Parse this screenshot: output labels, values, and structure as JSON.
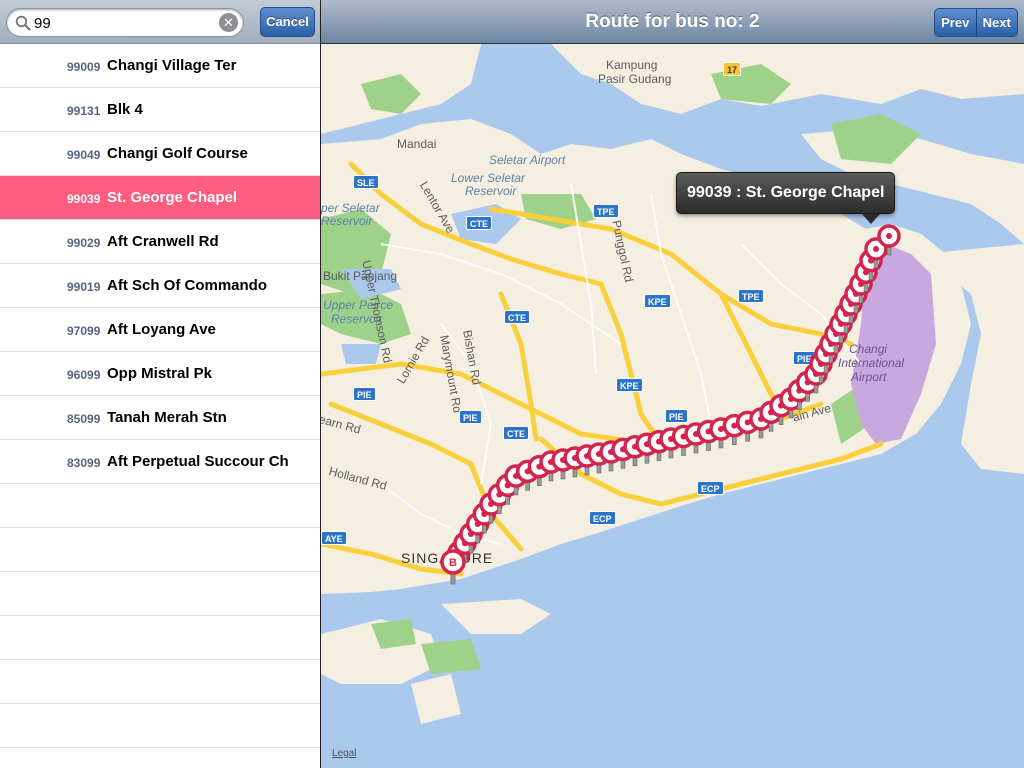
{
  "search": {
    "value": "99",
    "placeholder": "",
    "clear_icon": "clear-icon",
    "cancel_label": "Cancel"
  },
  "stops": [
    {
      "code": "99009",
      "name": "Changi Village Ter",
      "selected": false
    },
    {
      "code": "99131",
      "name": "Blk 4",
      "selected": false
    },
    {
      "code": "99049",
      "name": "Changi Golf Course",
      "selected": false
    },
    {
      "code": "99039",
      "name": "St. George Chapel",
      "selected": true
    },
    {
      "code": "99029",
      "name": "Aft Cranwell Rd",
      "selected": false
    },
    {
      "code": "99019",
      "name": "Aft Sch Of Commando",
      "selected": false
    },
    {
      "code": "97099",
      "name": "Aft Loyang Ave",
      "selected": false
    },
    {
      "code": "96099",
      "name": "Opp Mistral Pk",
      "selected": false
    },
    {
      "code": "85099",
      "name": "Tanah Merah Stn",
      "selected": false
    },
    {
      "code": "83099",
      "name": "Aft Perpetual Succour Ch",
      "selected": false
    }
  ],
  "nav": {
    "title": "Route for bus no: 2",
    "prev_label": "Prev",
    "next_label": "Next"
  },
  "map": {
    "callout": "99039 : St. George Chapel",
    "start_pin_label": "B",
    "legal": "Legal",
    "labels": {
      "kampung": "Kampung",
      "pasir_gudang": "Pasir Gudang",
      "mandai": "Mandai",
      "seletar_airport": "Seletar Airport",
      "lower_seletar_1": "Lower Seletar",
      "lower_seletar_2": "Reservoir",
      "upper_seletar_1": "per Seletar",
      "upper_seletar_2": "Reservoir",
      "bukit_panjang": "Bukit Panjang",
      "upper_peirce_1": "Upper Peirce",
      "upper_peirce_2": "Reservoir",
      "upper_thomson": "Upper Thomson Rd",
      "lentor": "Lentor Ave",
      "punggol": "Punggol Rd",
      "marymount": "Marymount Rd",
      "bishan": "Bishan Rd",
      "lornie": "Lornie Rd",
      "holland": "Holland Rd",
      "kearn": "earn Rd",
      "airport_1": "Changi",
      "airport_2": "International",
      "airport_3": "Airport",
      "singapore": "SINGAPORE",
      "loyang": "ain Ave"
    },
    "shields": {
      "sle": "SLE",
      "cte_1": "CTE",
      "cte_2": "CTE",
      "cte_3": "CTE",
      "tpe_1": "TPE",
      "tpe_2": "TPE",
      "kpe_1": "KPE",
      "kpe_2": "KPE",
      "pie_1": "PIE",
      "pie_2": "PIE",
      "pie_3": "PIE",
      "pie_4": "PIE",
      "ecp_1": "ECP",
      "ecp_2": "ECP",
      "aye": "AYE",
      "r17": "17"
    },
    "colors": {
      "water": "#aac9ec",
      "land": "#f4efe1",
      "park": "#9ed18a",
      "expressway": "#f9d03b",
      "route_pin": "#d4234d",
      "airport": "#c9a8e0"
    }
  }
}
